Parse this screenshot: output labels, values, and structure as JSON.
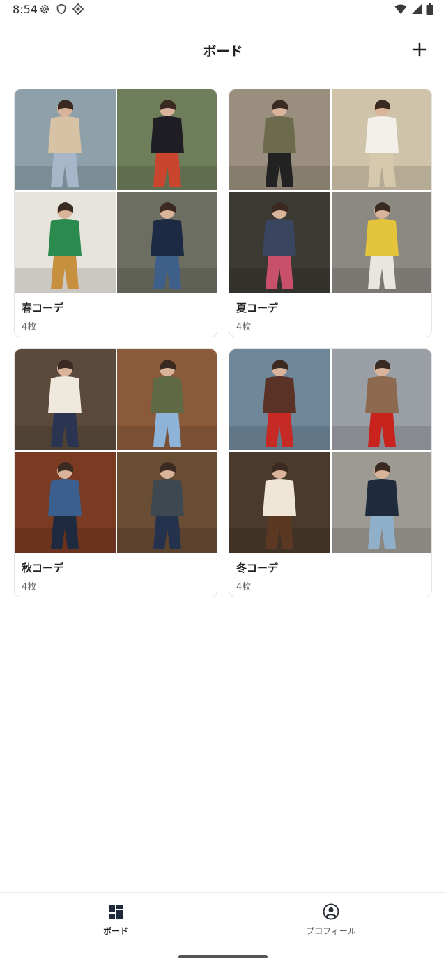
{
  "status_bar": {
    "time": "8:54"
  },
  "app_bar": {
    "title": "ボード",
    "add_icon": "plus-icon"
  },
  "boards": [
    {
      "title": "春コーデ",
      "count": "4枚",
      "photos": [
        {
          "bg": "#8ea0aa",
          "fg": "#d7c2a6",
          "accent": "#a7b7c9"
        },
        {
          "bg": "#6e7e5a",
          "fg": "#1e1e24",
          "accent": "#c9452e"
        },
        {
          "bg": "#e7e4de",
          "fg": "#2b8a4e",
          "accent": "#c7903e"
        },
        {
          "bg": "#6d6e62",
          "fg": "#1d2a44",
          "accent": "#3e5f8a"
        }
      ]
    },
    {
      "title": "夏コーデ",
      "count": "4枚",
      "photos": [
        {
          "bg": "#9a8f7f",
          "fg": "#6c6b4e",
          "accent": "#222222"
        },
        {
          "bg": "#cfc3aa",
          "fg": "#f3f0ea",
          "accent": "#d6c8ad"
        },
        {
          "bg": "#3b3a33",
          "fg": "#3a4660",
          "accent": "#c9506a"
        },
        {
          "bg": "#8c8882",
          "fg": "#e3c43a",
          "accent": "#e8e6df"
        }
      ]
    },
    {
      "title": "秋コーデ",
      "count": "4枚",
      "photos": [
        {
          "bg": "#5b4a3c",
          "fg": "#efe8dc",
          "accent": "#2b3552"
        },
        {
          "bg": "#8b5a3b",
          "fg": "#5f6a45",
          "accent": "#8db3d9"
        },
        {
          "bg": "#7a3b22",
          "fg": "#3b5f8e",
          "accent": "#1e2a40"
        },
        {
          "bg": "#6a4d35",
          "fg": "#3d4850",
          "accent": "#24324e"
        }
      ]
    },
    {
      "title": "冬コーデ",
      "count": "4枚",
      "photos": [
        {
          "bg": "#6f8799",
          "fg": "#5a3326",
          "accent": "#c52a24"
        },
        {
          "bg": "#9a9fa6",
          "fg": "#8d6a4f",
          "accent": "#c8241d"
        },
        {
          "bg": "#4a3a2c",
          "fg": "#efe6d8",
          "accent": "#5b3822"
        },
        {
          "bg": "#9c9a92",
          "fg": "#1f2a3c",
          "accent": "#8fb0c8"
        }
      ]
    }
  ],
  "bottom_nav": [
    {
      "label": "ボード",
      "icon": "dashboard-icon",
      "active": true
    },
    {
      "label": "プロフィール",
      "icon": "account-circle-icon",
      "active": false
    }
  ]
}
